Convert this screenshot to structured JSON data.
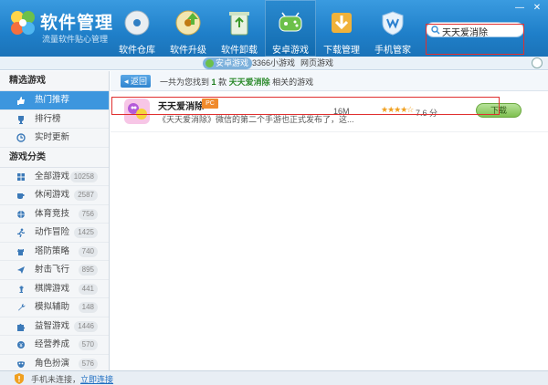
{
  "app": {
    "title": "软件管理",
    "subtitle": "流量软件贴心管理"
  },
  "window": {
    "minimize": "—",
    "close": "✕"
  },
  "nav": {
    "items": [
      {
        "label": "软件仓库",
        "icon": "disc-icon"
      },
      {
        "label": "软件升级",
        "icon": "upgrade-disc-icon"
      },
      {
        "label": "软件卸载",
        "icon": "recycle-bin-icon"
      },
      {
        "label": "安卓游戏",
        "icon": "android-gamepad-icon"
      },
      {
        "label": "下载管理",
        "icon": "download-icon"
      },
      {
        "label": "手机管家",
        "icon": "shield-icon"
      }
    ],
    "active_index": 3
  },
  "search": {
    "value": "天天爱消除"
  },
  "subbar": {
    "tabs": [
      {
        "label": "安卓游戏"
      },
      {
        "label": "3366小游戏"
      },
      {
        "label": "网页游戏"
      }
    ]
  },
  "sidebar": {
    "section1": "精选游戏",
    "featured": [
      {
        "label": "热门推荐",
        "icon": "thumbs-up-icon"
      },
      {
        "label": "排行榜",
        "icon": "trophy-icon"
      },
      {
        "label": "实时更新",
        "icon": "clock-icon"
      }
    ],
    "section2": "游戏分类",
    "categories": [
      {
        "label": "全部游戏",
        "count": "10258",
        "icon": "grid-icon"
      },
      {
        "label": "休闲游戏",
        "count": "2587",
        "icon": "coffee-icon"
      },
      {
        "label": "体育竞技",
        "count": "756",
        "icon": "ball-icon"
      },
      {
        "label": "动作冒险",
        "count": "1425",
        "icon": "runner-icon"
      },
      {
        "label": "塔防策略",
        "count": "740",
        "icon": "tower-icon"
      },
      {
        "label": "射击飞行",
        "count": "895",
        "icon": "plane-icon"
      },
      {
        "label": "棋牌游戏",
        "count": "441",
        "icon": "chess-icon"
      },
      {
        "label": "模拟辅助",
        "count": "148",
        "icon": "wrench-icon"
      },
      {
        "label": "益智游戏",
        "count": "1446",
        "icon": "puzzle-icon"
      },
      {
        "label": "经营养成",
        "count": "570",
        "icon": "coin-icon"
      },
      {
        "label": "角色扮演",
        "count": "576",
        "icon": "mask-icon"
      }
    ]
  },
  "results": {
    "back_label": "◂ 返回",
    "prefix": "一共为您找到",
    "count": "1",
    "unit": "款",
    "keyword": "天天爱消除",
    "suffix": "相关的游戏"
  },
  "apps": [
    {
      "name": "天天爱消除",
      "tag": "PC",
      "desc": "《天天爱消除》微信的第二个手游也正式发布了，这...",
      "size": "16M",
      "stars": "★★★★☆",
      "rating": 7.6,
      "score": "7.6 分",
      "download_label": "下载"
    }
  ],
  "footer": {
    "text": "手机未连接，",
    "link": "立即连接"
  },
  "colors": {
    "header": "#1f7fc9",
    "sidebar_active": "#3d96de",
    "download": "#7fc050",
    "tag": "#f08a2c"
  }
}
